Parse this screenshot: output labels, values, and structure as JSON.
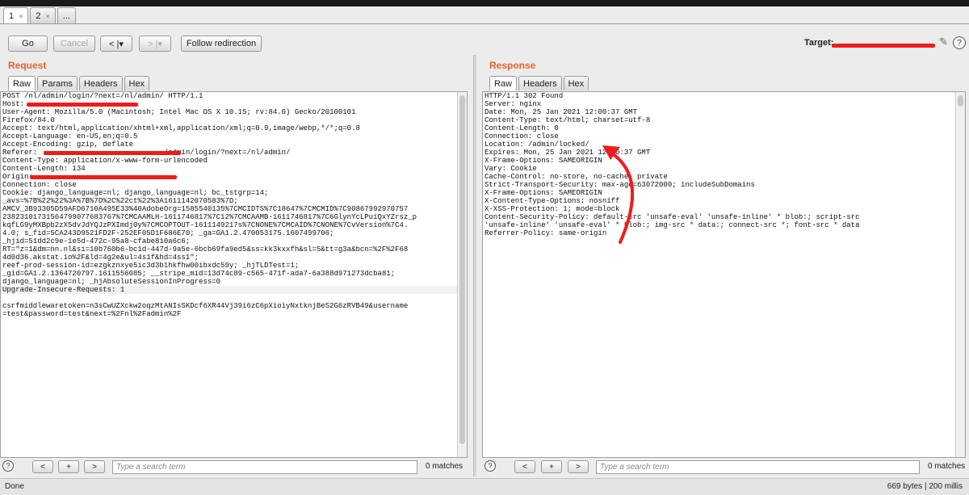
{
  "tabs": [
    {
      "label": "1",
      "close": "×"
    },
    {
      "label": "2",
      "close": "×"
    },
    {
      "label": "..."
    }
  ],
  "toolbar": {
    "go": "Go",
    "cancel": "Cancel",
    "back": "< |▾",
    "forward": "> |▾",
    "follow_redirection": "Follow redirection",
    "target_label": "Target:",
    "help": "?"
  },
  "request": {
    "title": "Request",
    "tabs": [
      "Raw",
      "Params",
      "Headers",
      "Hex"
    ],
    "lines": [
      "POST /nl/admin/login/?next=/nl/admin/ HTTP/1.1",
      "Host:",
      "User-Agent: Mozilla/5.0 (Macintosh; Intel Mac OS X 10.15; rv:84.0) Gecko/20100101",
      "Firefox/84.0",
      "Accept: text/html,application/xhtml+xml,application/xml;q=0.9,image/webp,*/*;q=0.8",
      "Accept-Language: en-US,en;q=0.5",
      "Accept-Encoding: gzip, deflate",
      "Referer:                             /admin/login/?next=/nl/admin/",
      "Content-Type: application/x-www-form-urlencoded",
      "Content-Length: 134",
      "Origin:",
      "Connection: close",
      "Cookie: django_language=nl; django_language=nl; bc_tstgrp=14;",
      "_avs=%7B%22%22%3A%7B%7D%2C%22ct%22%3A1611142070583%7D;",
      "AMCV_3B93305D59AFD6710A495E33%40AdobeOrg=1585540135%7CMCIDTS%7C18647%7CMCMID%7C90867992970757",
      "23823101731564799077683767%7CMCAAMLH-1611746817%7C12%7CMCAAMB-1611746817%7C6GlynYcLPuiQxYZrsz_p",
      "kqfLG9yMXBpb2zX5dvJdYQJzPXImdj0y%7CMCOPTOUT-1611149217s%7CNONE%7CMCAID%7CNONE%7CvVersion%7C4.",
      "4.0; s_fid=5CA243D9521FD2F-252EF05D1F686E70; _ga=GA1.2.470053175.1607499706;",
      "_hjid=51dd2c9e-1e5d-472c-95a8-cfabe810a6c6;",
      "RT=\"z=1&dm=nn.nl&si=10b760b6-bc1d-447d-9a5e-6bcb69fa9ed5&ss=kk3kxxfh&sl=5&tt=g3a&bcn=%2F%2F68",
      "4d0d36.akstat.io%2F&ld=4g2e&ul=4s1f&hd=4ss1\";",
      "reef-prod-session-id=ezgkznxye5ic3d3b1hkfhw00ibxdc59y; _hjTLDTest=1;",
      "_gid=GA1.2.1364720797.1611556085; __stripe_mid=13d74c89-c565-471f-ada7-6a388d971273dcba81;",
      "django_language=nl; _hjAbsoluteSessionInProgress=0",
      "Upgrade-Insecure-Requests: 1",
      "",
      "csrfmiddlewaretoken=n3sCwUZXckw2oqzMtANIsSKDcf6XR44Vj39i6zC6pXioiyNxtknjBeS2G6zRVB49&username",
      "=test&password=test&next=%2Fnl%2Fadmin%2F"
    ],
    "search_placeholder": "Type a search term",
    "matches": "0 matches"
  },
  "response": {
    "title": "Response",
    "tabs": [
      "Raw",
      "Headers",
      "Hex"
    ],
    "lines": [
      "HTTP/1.1 302 Found",
      "Server: nginx",
      "Date: Mon, 25 Jan 2021 12:00:37 GMT",
      "Content-Type: text/html; charset=utf-8",
      "Content-Length: 0",
      "Connection: close",
      "Location: /admin/locked/",
      "Expires: Mon, 25 Jan 2021 12:00:37 GMT",
      "X-Frame-Options: SAMEORIGIN",
      "Vary: Cookie",
      "Cache-Control: no-store, no-cache, private",
      "Strict-Transport-Security: max-age=63072000; includeSubDomains",
      "X-Frame-Options: SAMEORIGIN",
      "X-Content-Type-Options: nosniff",
      "X-XSS-Protection: 1; mode=block",
      "Content-Security-Policy: default-src 'unsafe-eval' 'unsafe-inline' * blob:; script-src",
      "'unsafe-inline' 'unsafe-eval' * blob:; img-src * data:; connect-src *; font-src * data",
      "Referrer-Policy: same-origin"
    ],
    "search_placeholder": "Type a search term",
    "matches": "0 matches"
  },
  "search_buttons": {
    "prev": "<",
    "add": "+",
    "next": ">",
    "help": "?"
  },
  "status": {
    "left": "Done",
    "right": "669 bytes | 200 millis"
  },
  "colors": {
    "accent": "#e8622a",
    "redaction": "#ee1c1c",
    "key": "#1f3fae",
    "value": "#b22a1a"
  }
}
